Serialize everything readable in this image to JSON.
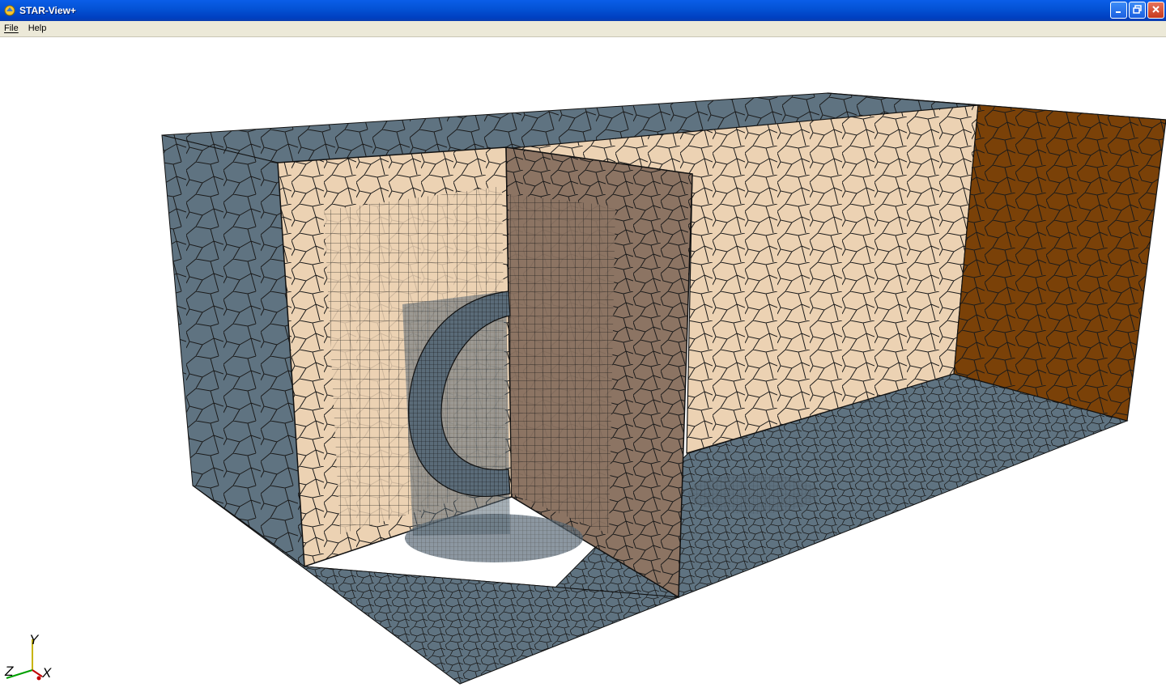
{
  "window": {
    "title": "STAR-View+"
  },
  "menu": [
    {
      "label": "File",
      "underline": "F"
    },
    {
      "label": "Help",
      "underline": "H"
    }
  ],
  "axes": {
    "y_label": "Y",
    "z_label": "Z",
    "x_label": "X"
  },
  "colors": {
    "boundary_walls": "#5f7381",
    "section_plane_light": "#ecd2b3",
    "section_plane_dark": "#8c7463",
    "outlet_wall": "#7a4108",
    "mesh_lines": "#000000",
    "title_bar": "#0453d6",
    "menu_bar": "#ece9d8"
  },
  "icons": [
    "app-icon",
    "minimize-icon",
    "restore-icon",
    "close-icon"
  ]
}
